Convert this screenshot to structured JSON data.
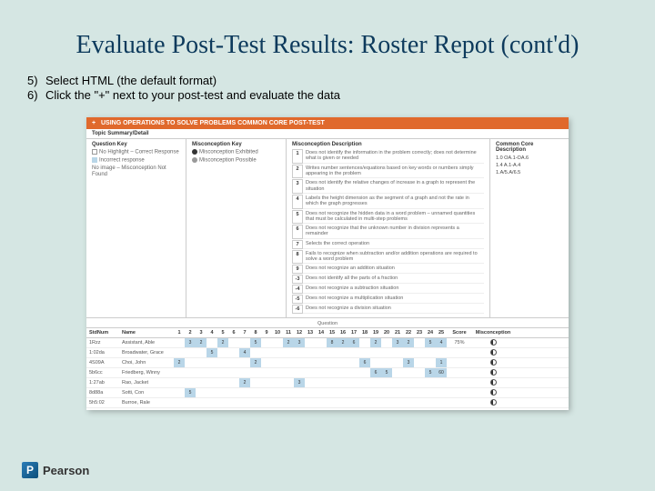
{
  "title": "Evaluate Post-Test Results: Roster Repot (cont'd)",
  "instructions": [
    {
      "num": "5)",
      "text": "Select HTML (the default format)"
    },
    {
      "num": "6)",
      "text": "Click the \"+\" next to your post-test and evaluate the data"
    }
  ],
  "report": {
    "header": "USING OPERATIONS TO SOLVE PROBLEMS COMMON CORE POST-TEST",
    "topic_label": "Topic Summary/Detail",
    "columns": {
      "question_key": "Question Key",
      "misconception_key": "Misconception Key",
      "misconception_desc": "Misconception Description",
      "common_core": "Common Core Description"
    },
    "question_key_items": [
      "No Highlight – Correct Response",
      "Incorrect response",
      "No image – Misconception Not Found"
    ],
    "misconception_key_items": [
      "Misconception Exhibited",
      "Misconception Possible"
    ],
    "misconceptions": [
      {
        "n": "1",
        "text": "Does not identify the information in the problem correctly; does not determine what is given or needed"
      },
      {
        "n": "2",
        "text": "Writes number sentences/equations based on key words or numbers simply appearing in the problem"
      },
      {
        "n": "3",
        "text": "Does not identify the relative changes of increase in a graph to represent the situation"
      },
      {
        "n": "4",
        "text": "Labels the height dimension as the segment of a graph and not the rate in which the graph progresses"
      },
      {
        "n": "5",
        "text": "Does not recognize the hidden data in a word problem – unnamed quantities that must be calculated in multi-step problems"
      },
      {
        "n": "6",
        "text": "Does not recognize that the unknown number in division represents a remainder"
      },
      {
        "n": "7",
        "text": "Selects the correct operation"
      },
      {
        "n": "8",
        "text": "Fails to recognize when subtraction and/or addition operations are required to solve a word problem"
      },
      {
        "n": "9",
        "text": "Does not recognize an addition situation"
      },
      {
        "n": "-3",
        "text": "Does not identify all the parts of a fraction"
      },
      {
        "n": "-4",
        "text": "Does not recognize a subtraction situation"
      },
      {
        "n": "-5",
        "text": "Does not recognize a multiplication situation"
      },
      {
        "n": "-6",
        "text": "Does not recognize a division situation"
      }
    ],
    "common_core_codes": [
      "1.0 OA.1-OA.6",
      "1.4 A.1-A.4",
      "1.A/5.A/6.5"
    ],
    "table": {
      "q_header": "Question",
      "abs_header": "Misconception",
      "cols_studnum": "StdNum",
      "cols_name": "Name",
      "cols_score": "Score",
      "question_nums": [
        "1",
        "2",
        "3",
        "4",
        "5",
        "6",
        "7",
        "8",
        "9",
        "10",
        "11",
        "12",
        "13",
        "14",
        "15",
        "16",
        "17",
        "18",
        "19",
        "20",
        "21",
        "22",
        "23",
        "24",
        "25"
      ],
      "rows": [
        {
          "sn": "1Rzz",
          "name": "Assistant, Able",
          "cells": [
            "",
            "3",
            "2",
            "",
            "2",
            "",
            "",
            "5",
            "",
            "",
            "2",
            "3",
            "",
            "",
            "8",
            "2",
            "6",
            "",
            "2",
            "",
            "3",
            "2",
            "",
            "5",
            "4"
          ],
          "score": "75%"
        },
        {
          "sn": "1:02da",
          "name": "Broadwater, Grace",
          "cells": [
            "",
            "",
            "",
            "5",
            "",
            "",
            "4",
            "",
            "",
            "",
            "",
            "",
            "",
            "",
            "",
            "",
            "",
            "",
            "",
            "",
            "",
            "",
            "",
            "",
            ""
          ],
          "score": ""
        },
        {
          "sn": "4S09A",
          "name": "Choi, John",
          "cells": [
            "2",
            "",
            "",
            "",
            "",
            "",
            "",
            "2",
            "",
            "",
            "",
            "",
            "",
            "",
            "",
            "",
            "",
            "6",
            "",
            "",
            "",
            "3",
            "",
            "",
            "1"
          ],
          "score": ""
        },
        {
          "sn": "5b6cc",
          "name": "Friedberg, Winny",
          "cells": [
            "",
            "",
            "",
            "",
            "",
            "",
            "",
            "",
            "",
            "",
            "",
            "",
            "",
            "",
            "",
            "",
            "",
            "",
            "6",
            "5",
            "",
            "",
            "",
            "5",
            "60"
          ],
          "score": ""
        },
        {
          "sn": "1:27ab",
          "name": "Rao, Jacket",
          "cells": [
            "",
            "",
            "",
            "",
            "",
            "",
            "2",
            "",
            "",
            "",
            "",
            "3",
            "",
            "",
            "",
            "",
            "",
            "",
            "",
            "",
            "",
            "",
            "",
            "",
            ""
          ],
          "score": ""
        },
        {
          "sn": "8d88a",
          "name": "Sotti, Con",
          "cells": [
            "",
            "5",
            "",
            "",
            "",
            "",
            "",
            "",
            "",
            "",
            "",
            "",
            "",
            "",
            "",
            "",
            "",
            "",
            "",
            "",
            "",
            "",
            "",
            "",
            ""
          ],
          "score": ""
        },
        {
          "sn": "5h5:02",
          "name": "Burroe, Rale",
          "cells": [
            "",
            "",
            "",
            "",
            "",
            "",
            "",
            "",
            "",
            "",
            "",
            "",
            "",
            "",
            "",
            "",
            "",
            "",
            "",
            "",
            "",
            "",
            "",
            "",
            ""
          ],
          "score": ""
        }
      ]
    }
  },
  "footer": {
    "logo": "P",
    "brand": "Pearson"
  }
}
